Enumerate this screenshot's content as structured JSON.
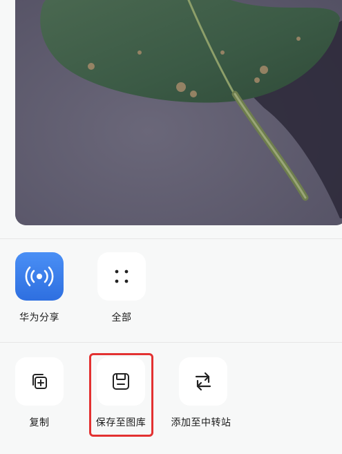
{
  "share_sheet": {
    "preview": {
      "icon": "leaf-photo"
    },
    "row1": [
      {
        "label": "华为分享",
        "icon": "huawei-share-icon",
        "color": "#3a7ff0"
      },
      {
        "label": "全部",
        "icon": "four-dots-icon"
      }
    ],
    "row2": [
      {
        "label": "复制",
        "icon": "copy-icon"
      },
      {
        "label": "保存至图库",
        "icon": "save-icon"
      },
      {
        "label": "添加至中转站",
        "icon": "relay-station-icon"
      }
    ],
    "highlight_color": "#e33131"
  }
}
